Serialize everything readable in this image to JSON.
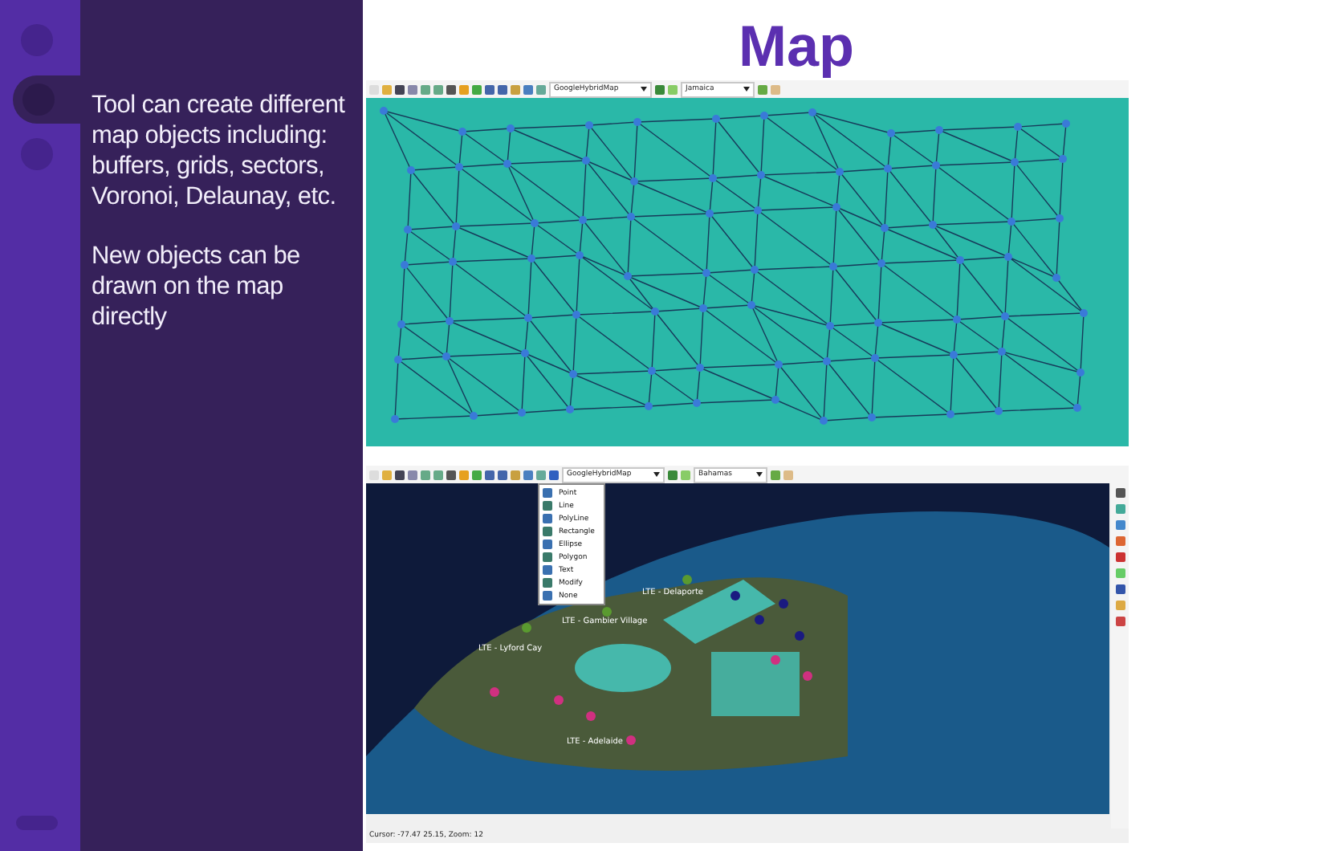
{
  "sidebar": {
    "paragraphs": [
      "Tool can create different map objects including: buffers, grids, sectors, Voronoi, Delaunay, etc.",
      "New objects can be drawn on the map directly"
    ]
  },
  "title": "Map",
  "screenshots": [
    {
      "kind": "delaunay",
      "map_source": "GoogleHybridMap",
      "region": "Jamaica"
    },
    {
      "kind": "satellite",
      "map_source": "GoogleHybridMap",
      "region": "Bahamas",
      "draw_menu": [
        "Point",
        "Line",
        "PolyLine",
        "Rectangle",
        "Ellipse",
        "Polygon",
        "Text",
        "Modify",
        "None"
      ],
      "site_labels": [
        "LTE - Delaporte",
        "LTE - Gambier Village",
        "LTE - Lyford Cay",
        "LTE - Adelaide"
      ],
      "status_bar": "Cursor: -77.47 25.15, Zoom: 12"
    }
  ]
}
